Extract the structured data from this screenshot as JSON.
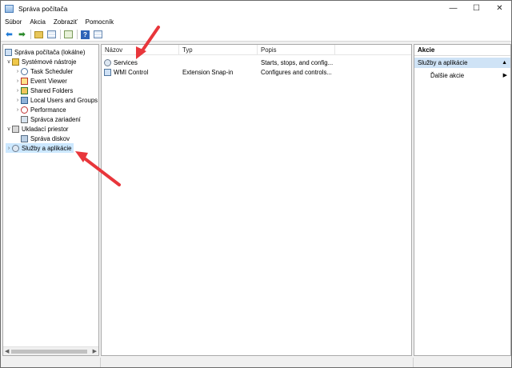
{
  "window": {
    "title": "Správa počítača"
  },
  "menu": [
    "Súbor",
    "Akcia",
    "Zobraziť",
    "Pomocník"
  ],
  "tree": {
    "root": "Správa počítača (lokálne)",
    "items": [
      {
        "label": "Systémové nástroje",
        "icon": "system-tools-icon",
        "expanded": true
      },
      {
        "label": "Task Scheduler",
        "icon": "task-scheduler-icon"
      },
      {
        "label": "Event Viewer",
        "icon": "event-viewer-icon"
      },
      {
        "label": "Shared Folders",
        "icon": "shared-folders-icon"
      },
      {
        "label": "Local Users and Groups",
        "icon": "local-users-icon"
      },
      {
        "label": "Performance",
        "icon": "performance-icon"
      },
      {
        "label": "Správca zariadení",
        "icon": "device-manager-icon"
      },
      {
        "label": "Ukladací priestor",
        "icon": "storage-icon",
        "expanded": true
      },
      {
        "label": "Správa diskov",
        "icon": "disk-management-icon"
      },
      {
        "label": "Služby a aplikácie",
        "icon": "services-apps-icon",
        "selected": true
      }
    ]
  },
  "list": {
    "columns": [
      "Názov",
      "Typ",
      "Popis"
    ],
    "rows": [
      {
        "name": "Services",
        "type": "",
        "desc": "Starts, stops, and config..."
      },
      {
        "name": "WMI Control",
        "type": "Extension Snap-in",
        "desc": "Configures and controls..."
      }
    ]
  },
  "actions": {
    "title": "Akcie",
    "section": "Služby a aplikácie",
    "items": [
      "Ďalšie akcie"
    ]
  },
  "colors": {
    "selection": "#cce8ff",
    "annotation_arrow": "#e8363b"
  }
}
